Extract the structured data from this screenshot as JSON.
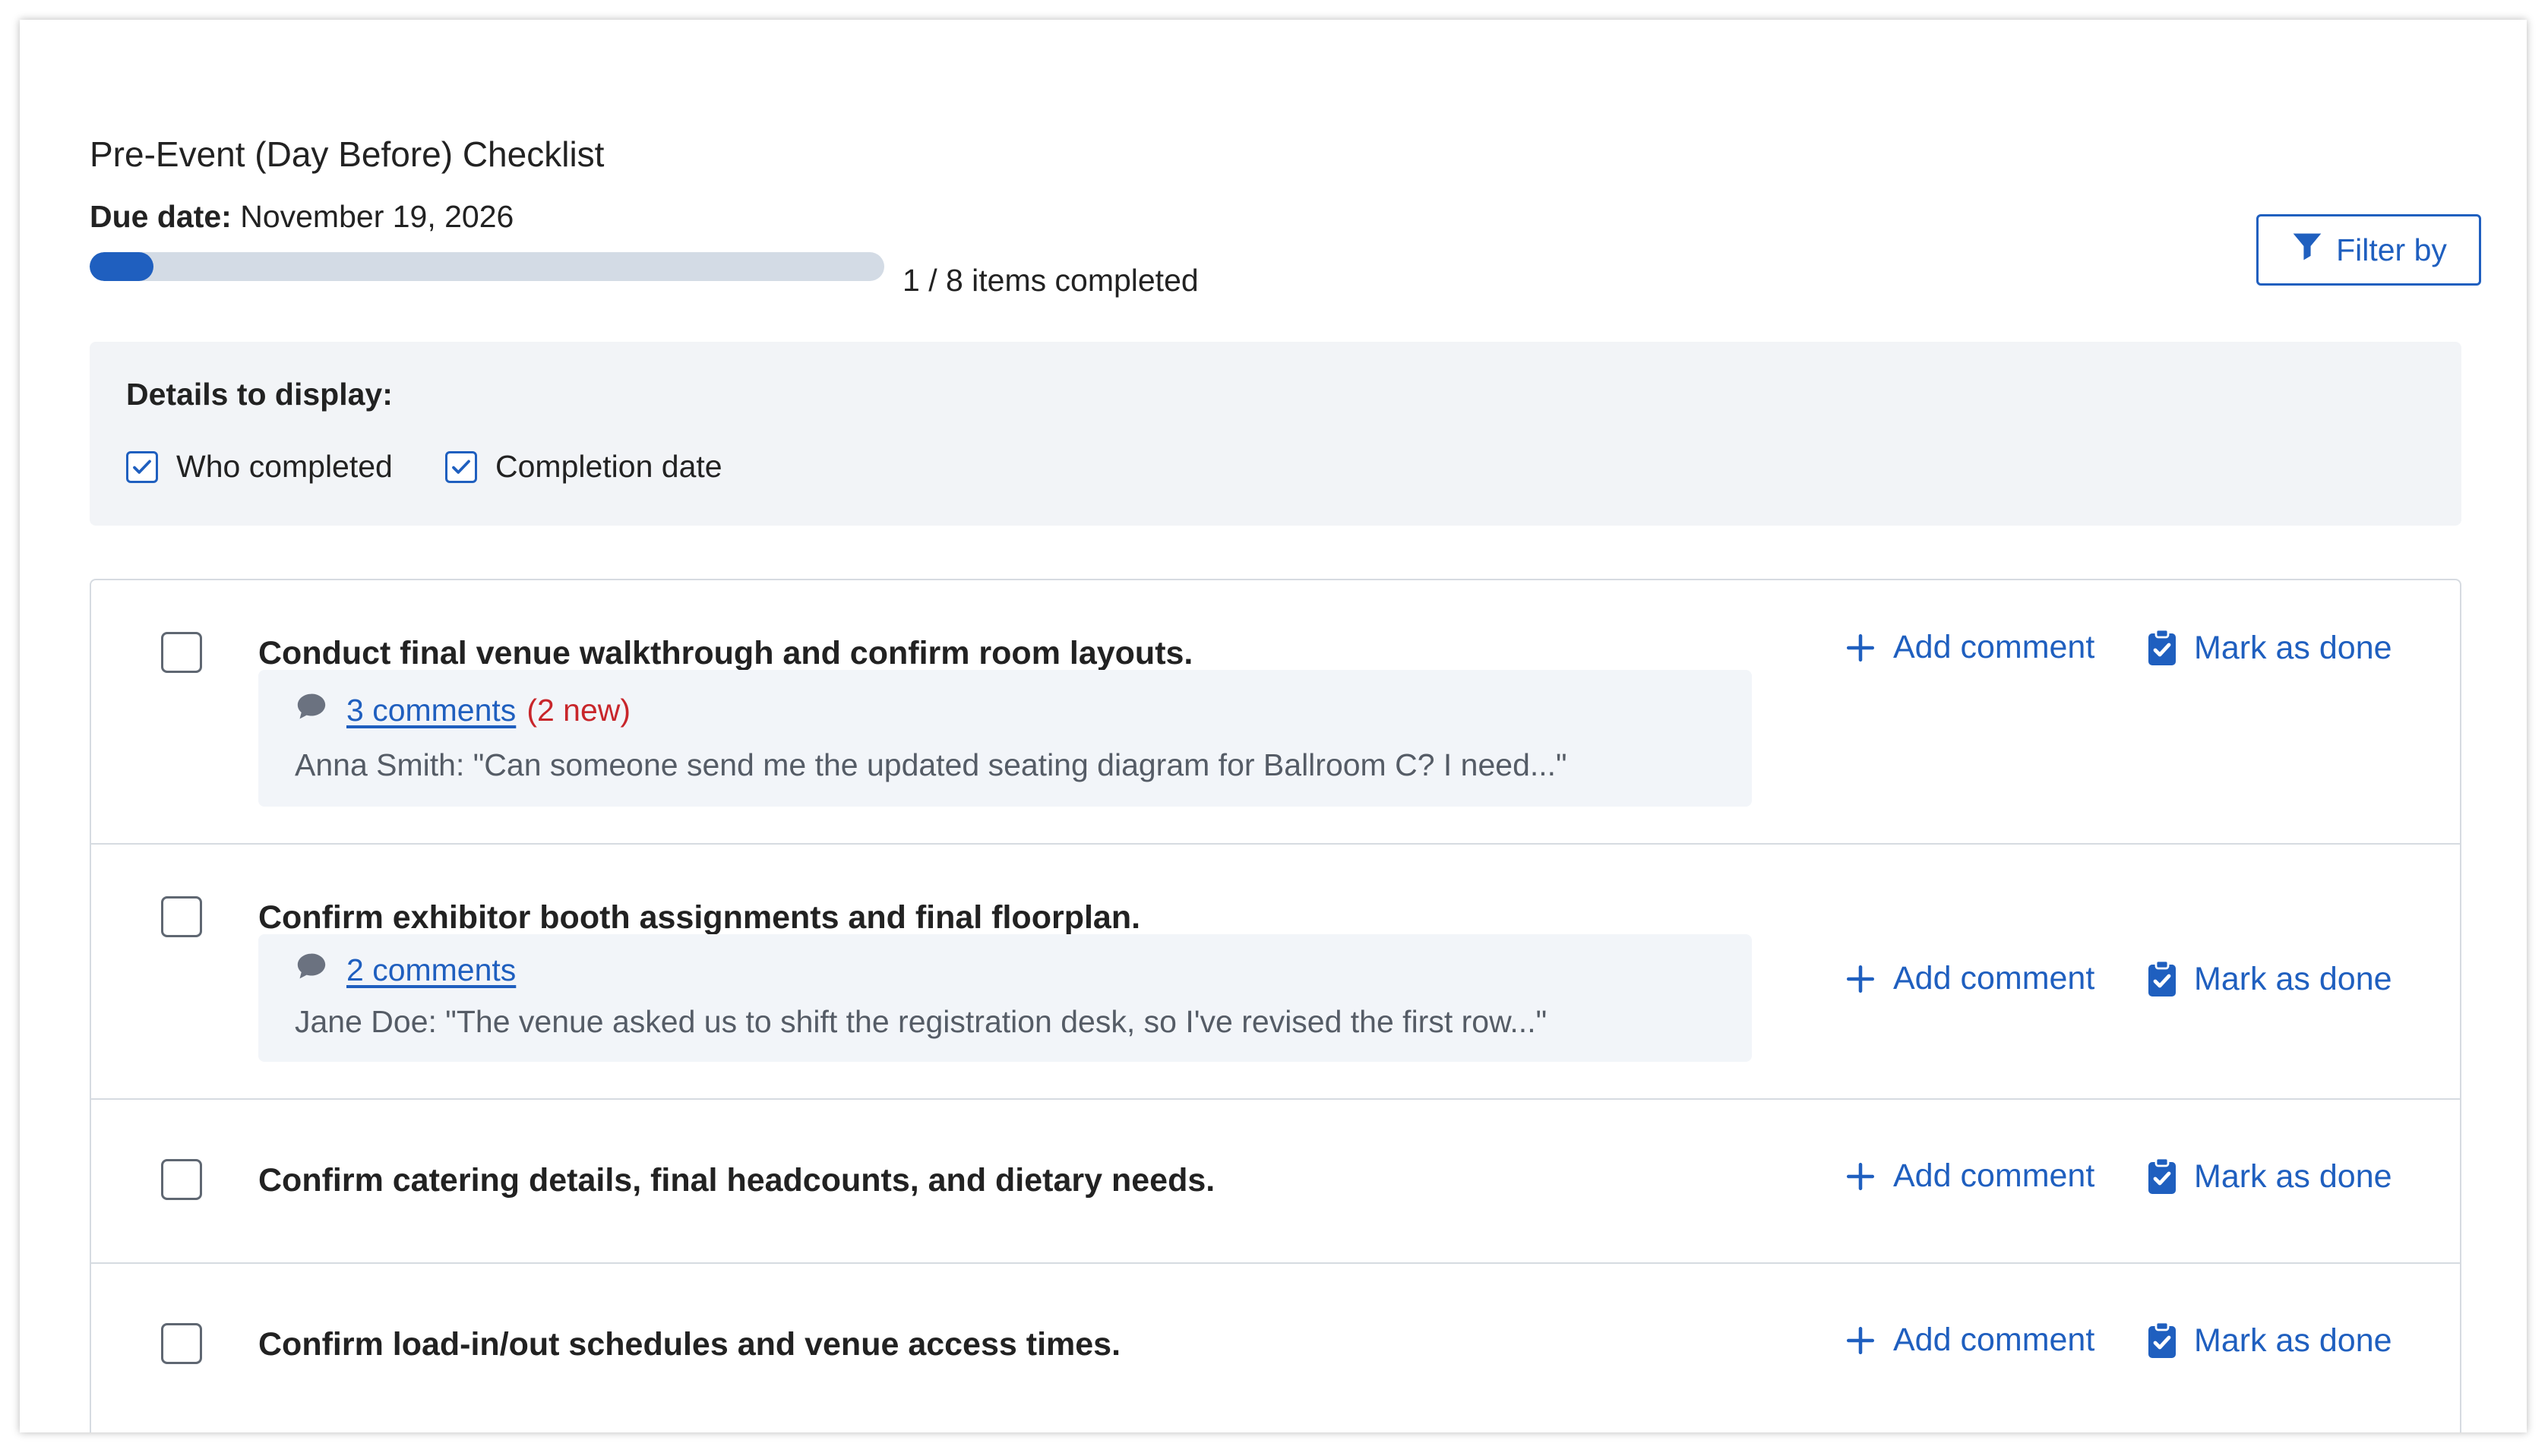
{
  "checklist": {
    "title": "Pre-Event (Day Before) Checklist",
    "due_label": "Due date:",
    "due_value": "November 19, 2026",
    "progress": {
      "completed": 1,
      "total": 8,
      "fraction": 0.08,
      "text": "1 / 8 items completed"
    },
    "filter_label": "Filter by"
  },
  "details": {
    "label": "Details to display:",
    "options": [
      {
        "label": "Who completed",
        "checked": true
      },
      {
        "label": "Completion date",
        "checked": true
      }
    ]
  },
  "actions": {
    "add_comment": "Add comment",
    "mark_done": "Mark as done"
  },
  "items": [
    {
      "text": "Conduct final venue walkthrough and confirm room layouts.",
      "comments_link": "3 comments",
      "comments_new": "(2 new)",
      "snippet": "Anna Smith: \"Can someone send me the updated seating diagram for Ballroom C? I need...\""
    },
    {
      "text": "Confirm exhibitor booth assignments and final floorplan.",
      "comments_link": "2 comments",
      "snippet": "Jane Doe: \"The venue asked us to shift the registration desk, so I've revised the first row...\""
    },
    {
      "text": "Confirm catering details, final headcounts, and dietary needs."
    },
    {
      "text": "Confirm load-in/out schedules and venue access times."
    }
  ],
  "colors": {
    "accent": "#1f5fbf",
    "new_badge": "#c8262b",
    "panel_bg": "#f2f4f7",
    "border": "#d6dbe1"
  },
  "icons": {
    "filter": "funnel-icon",
    "comment": "speech-bubble-icon",
    "add": "plus-icon",
    "done": "clipboard-check-icon",
    "checkbox": "check-icon"
  }
}
